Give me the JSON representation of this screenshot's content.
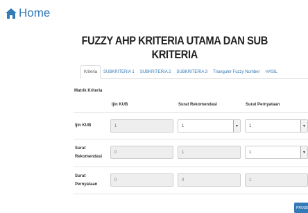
{
  "nav": {
    "home_label": "Home",
    "home_icon": "home-icon"
  },
  "page": {
    "title": "FUZZY AHP KRITERIA UTAMA DAN SUB KRITERIA"
  },
  "tabs": [
    {
      "label": "Kriteria",
      "active": true
    },
    {
      "label": "SUBKRITERIA 1",
      "active": false
    },
    {
      "label": "SUBKRITERIA 2",
      "active": false
    },
    {
      "label": "SUBKRITERIA 3",
      "active": false
    },
    {
      "label": "Trianguler Fuzzy Number",
      "active": false
    },
    {
      "label": "HASIL",
      "active": false
    }
  ],
  "matrix": {
    "label": "Matrik Kriteria",
    "columns": [
      "Ijin KUB",
      "Surat Rekomendasi",
      "Surat Pernyataan"
    ],
    "rows": [
      {
        "label": "Ijin KUB",
        "cells": [
          {
            "value": "1",
            "type": "readonly"
          },
          {
            "value": "1",
            "type": "select"
          },
          {
            "value": "1",
            "type": "select"
          }
        ]
      },
      {
        "label": "Surat Rekomendasi",
        "cells": [
          {
            "value": "0",
            "type": "readonly"
          },
          {
            "value": "1",
            "type": "readonly"
          },
          {
            "value": "1",
            "type": "select"
          }
        ]
      },
      {
        "label": "Surat Pernyataan",
        "cells": [
          {
            "value": "0",
            "type": "readonly"
          },
          {
            "value": "0",
            "type": "readonly"
          },
          {
            "value": "1",
            "type": "readonly"
          }
        ]
      }
    ]
  },
  "actions": {
    "process_label": "PROSES"
  },
  "colors": {
    "link": "#337ab7",
    "border": "#cccccc",
    "readonly_bg": "#eeeeee"
  }
}
